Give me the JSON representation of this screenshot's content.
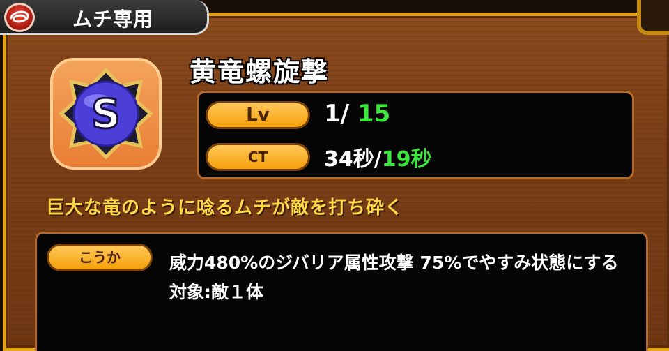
{
  "tab": {
    "label": "ムチ専用",
    "icon": "whip-icon"
  },
  "skill": {
    "name": "黄竜螺旋撃",
    "icon": "skill-orb-s-icon",
    "icon_letter": "S",
    "level": {
      "label": "Lv",
      "current": "1/",
      "max": "15"
    },
    "cooldown": {
      "label": "CT",
      "base": "34秒/",
      "current": "19秒"
    },
    "description": "巨大な竜のように唸るムチが敵を打ち砕く",
    "effect": {
      "label": "こうか",
      "line1": "威力480%のジバリア属性攻撃 75%でやすみ状態にする",
      "line2": "対象:敵１体"
    }
  },
  "colors": {
    "frame_gold": "#e0a21a",
    "panel_bg": "#050505",
    "highlight_green": "#3ce63c",
    "desc_yellow": "#ffd84a",
    "pill_orange": "#f5a00a"
  }
}
